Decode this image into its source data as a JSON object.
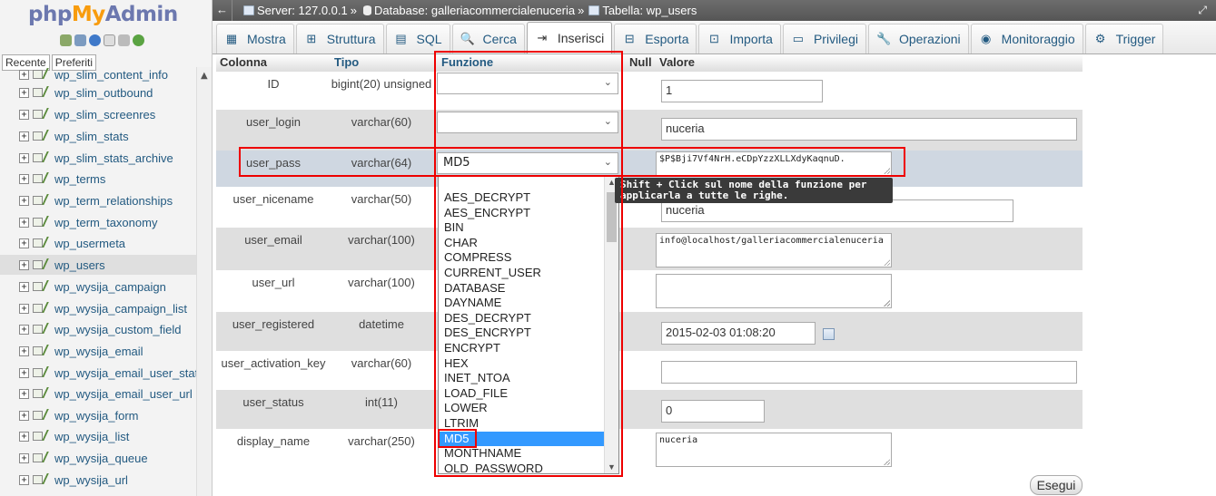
{
  "logo": {
    "php": "php",
    "my": "My",
    "admin": "Admin"
  },
  "sidebar": {
    "recent_label": "Recente",
    "favorites_label": "Preferiti",
    "tables": [
      "wp_slim_content_info",
      "wp_slim_outbound",
      "wp_slim_screenres",
      "wp_slim_stats",
      "wp_slim_stats_archive",
      "wp_terms",
      "wp_term_relationships",
      "wp_term_taxonomy",
      "wp_usermeta",
      "wp_users",
      "wp_wysija_campaign",
      "wp_wysija_campaign_list",
      "wp_wysija_custom_field",
      "wp_wysija_email",
      "wp_wysija_email_user_stat",
      "wp_wysija_email_user_url",
      "wp_wysija_form",
      "wp_wysija_list",
      "wp_wysija_queue",
      "wp_wysija_url"
    ],
    "active_table": "wp_users"
  },
  "breadcrumb": {
    "server": "Server: 127.0.0.1",
    "sep": "»",
    "database": "Database: galleriacommercialenuceria",
    "table": "Tabella: wp_users"
  },
  "tabs": [
    {
      "label": "Mostra",
      "icon": "browse-icon"
    },
    {
      "label": "Struttura",
      "icon": "structure-icon"
    },
    {
      "label": "SQL",
      "icon": "sql-icon"
    },
    {
      "label": "Cerca",
      "icon": "search-icon"
    },
    {
      "label": "Inserisci",
      "icon": "insert-icon"
    },
    {
      "label": "Esporta",
      "icon": "export-icon"
    },
    {
      "label": "Importa",
      "icon": "import-icon"
    },
    {
      "label": "Privilegi",
      "icon": "privileges-icon"
    },
    {
      "label": "Operazioni",
      "icon": "wrench-icon"
    },
    {
      "label": "Monitoraggio",
      "icon": "eye-icon"
    },
    {
      "label": "Trigger",
      "icon": "trigger-icon"
    }
  ],
  "active_tab": "Inserisci",
  "table": {
    "headers": {
      "column": "Colonna",
      "type": "Tipo",
      "function": "Funzione",
      "null": "Null",
      "value": "Valore"
    },
    "rows": [
      {
        "name": "ID",
        "type": "bigint(20) unsigned",
        "function": "",
        "value": "1"
      },
      {
        "name": "user_login",
        "type": "varchar(60)",
        "function": "",
        "value": "nuceria"
      },
      {
        "name": "user_pass",
        "type": "varchar(64)",
        "function": "MD5",
        "value": "$P$Bji7Vf4NrH.eCDpYzzXLLXdyKaqnuD."
      },
      {
        "name": "user_nicename",
        "type": "varchar(50)",
        "function": "",
        "value": "nuceria"
      },
      {
        "name": "user_email",
        "type": "varchar(100)",
        "function": "",
        "value": "info@localhost/galleriacommercialenuceria"
      },
      {
        "name": "user_url",
        "type": "varchar(100)",
        "function": "",
        "value": ""
      },
      {
        "name": "user_registered",
        "type": "datetime",
        "function": "",
        "value": "2015-02-03 01:08:20"
      },
      {
        "name": "user_activation_key",
        "type": "varchar(60)",
        "function": "",
        "value": ""
      },
      {
        "name": "user_status",
        "type": "int(11)",
        "function": "",
        "value": "0"
      },
      {
        "name": "display_name",
        "type": "varchar(250)",
        "function": "",
        "value": "nuceria"
      }
    ]
  },
  "function_dropdown": {
    "options": [
      "AES_DECRYPT",
      "AES_ENCRYPT",
      "BIN",
      "CHAR",
      "COMPRESS",
      "CURRENT_USER",
      "DATABASE",
      "DAYNAME",
      "DES_DECRYPT",
      "DES_ENCRYPT",
      "ENCRYPT",
      "HEX",
      "INET_NTOA",
      "LOAD_FILE",
      "LOWER",
      "LTRIM",
      "MD5",
      "MONTHNAME",
      "OLD_PASSWORD"
    ],
    "selected": "MD5"
  },
  "tooltip": {
    "line1": "Shift + Click sul nome della funzione per",
    "line2": "applicarla a tutte le righe."
  },
  "go_button": "Esegui",
  "colors": {
    "link": "#235a81",
    "selected": "#3399ff",
    "annotation": "#e00000",
    "topbar": "#5e5e5e"
  }
}
